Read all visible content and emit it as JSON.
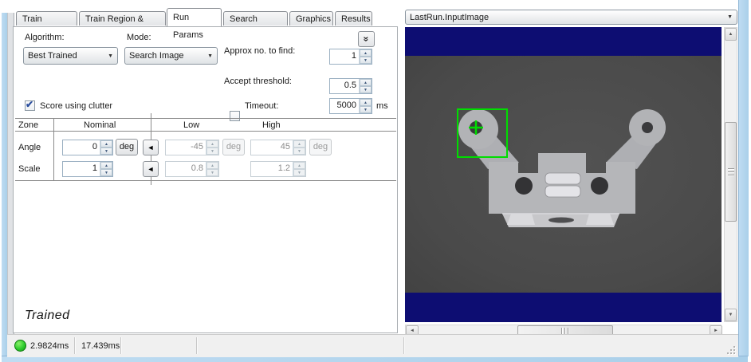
{
  "tabs": [
    {
      "label": "Train Params"
    },
    {
      "label": "Train Region & Origin"
    },
    {
      "label": "Run Params"
    },
    {
      "label": "Search Region"
    },
    {
      "label": "Graphics"
    },
    {
      "label": "Results"
    }
  ],
  "active_tab": "Run Params",
  "run_params": {
    "algorithm": {
      "label": "Algorithm:",
      "value": "Best Trained"
    },
    "mode": {
      "label": "Mode:",
      "value": "Search Image"
    },
    "approx": {
      "label": "Approx no. to find:",
      "value": "1"
    },
    "accept": {
      "label": "Accept threshold:",
      "value": "0.5"
    },
    "clutter": {
      "label": "Score using clutter",
      "checked": true
    },
    "timeout": {
      "label": "Timeout:",
      "value": "5000",
      "unit": "ms",
      "checked": false
    }
  },
  "zone_table": {
    "headers": {
      "zone": "Zone",
      "nominal": "Nominal",
      "low": "Low",
      "high": "High"
    },
    "angle": {
      "label": "Angle",
      "nominal": "0",
      "nominal_unit": "deg",
      "low": "-45",
      "low_unit": "deg",
      "high": "45",
      "high_unit": "deg"
    },
    "scale": {
      "label": "Scale",
      "nominal": "1",
      "low": "0.8",
      "high": "1.2"
    }
  },
  "state_label": "Trained",
  "statusbar": {
    "time_total": "2.9824ms",
    "time_tool": "17.439ms"
  },
  "image_panel": {
    "record_selector": "LastRun.InputImage"
  },
  "icons": {
    "check": "✔",
    "combo_caret": "▼",
    "spin_up": "▲",
    "spin_down": "▼",
    "reverse": "◄",
    "chevron_collapse": "»",
    "scroll_up": "▲",
    "scroll_down": "▼",
    "scroll_left": "◄",
    "scroll_right": "►"
  },
  "colors": {
    "navy_band": "#0d0d72",
    "image_background": "#4b4b4b",
    "bracket_gray": "#b2b3b6",
    "annotation_green": "#00dd00",
    "window_border_blue": "#b5d7ee"
  }
}
